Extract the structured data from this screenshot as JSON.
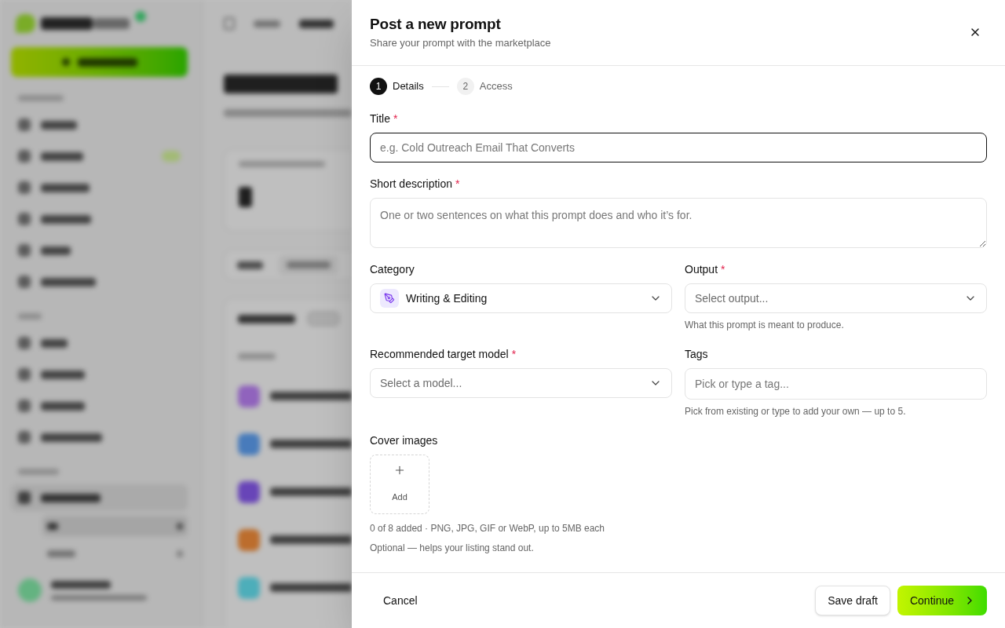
{
  "header": {
    "title": "Post a new prompt",
    "subtitle": "Share your prompt with the marketplace"
  },
  "steps": [
    {
      "number": "1",
      "label": "Details",
      "selected": true
    },
    {
      "number": "2",
      "label": "Access",
      "selected": false
    }
  ],
  "required_mark": "*",
  "fields": [
    {
      "kind": "text",
      "label": "Title",
      "required": true,
      "focused": true,
      "placeholder": "e.g. Cold Outreach Email That Converts"
    },
    {
      "kind": "textarea",
      "label": "Short description",
      "required": true,
      "focused": false,
      "placeholder": "One or two sentences on what this prompt does and who it’s for."
    }
  ],
  "field_grid": [
    {
      "kind": "select",
      "label": "Category",
      "focused": false,
      "value": "Writing & Editing"
    },
    {
      "kind": "select",
      "label": "Output",
      "required": true,
      "focused": false,
      "placeholder": "Select output...",
      "hint": "What this prompt is meant to produce."
    },
    {
      "kind": "select",
      "label": "Recommended target model",
      "required": true,
      "focused": false,
      "placeholder": "Select a model..."
    },
    {
      "kind": "tags",
      "label": "Tags",
      "focused": false,
      "placeholder": "Pick or type a tag...",
      "hint": "Pick from existing or type to add your own — up to 5."
    }
  ],
  "cover_images": {
    "label": "Cover images",
    "add_label": "Add",
    "notes": [
      "0 of 8 added · PNG, JPG, GIF or WebP, up to 5MB each",
      "Optional — helps your listing stand out."
    ]
  },
  "footer": {
    "cancel": "Cancel",
    "save": "Save draft",
    "continue": "Continue"
  }
}
